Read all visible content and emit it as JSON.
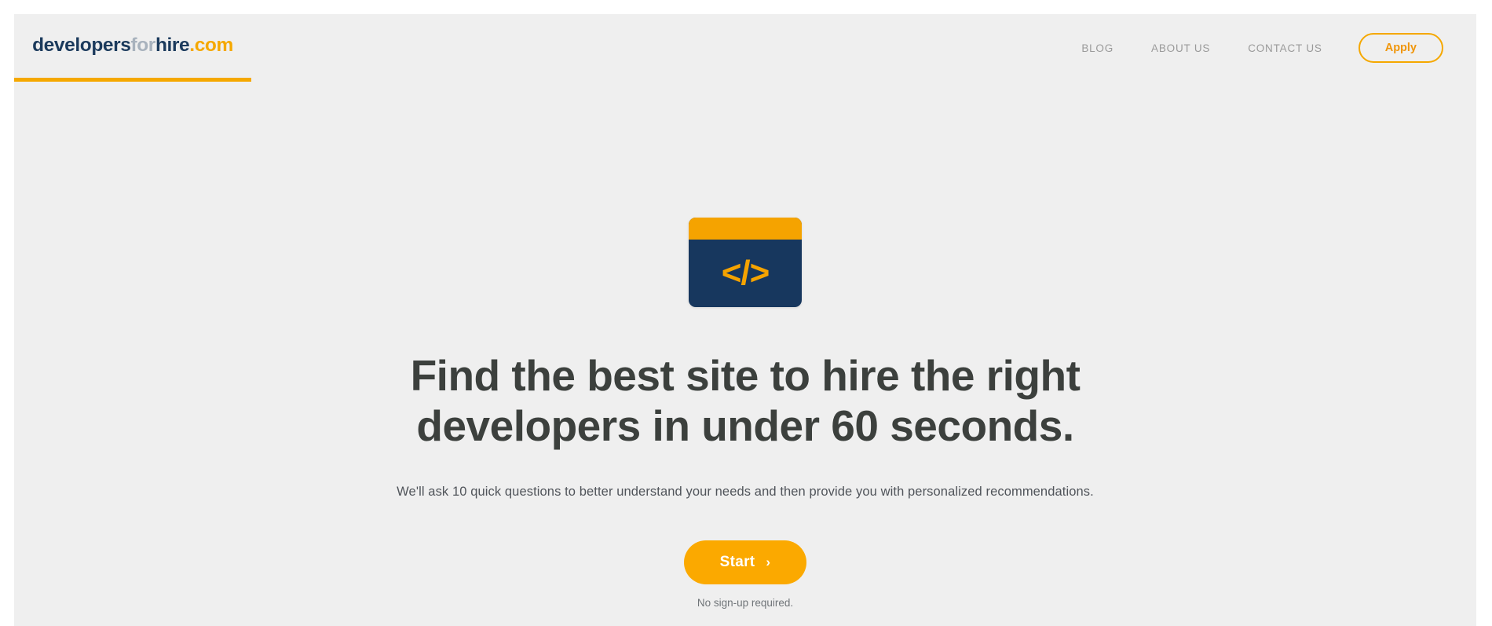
{
  "header": {
    "logo": {
      "part1": "developers",
      "part2": "for",
      "part3": "hire",
      "part4": ".com",
      "full_text": "developersforhire.com",
      "color_part1": "#1b3a5c",
      "color_part2": "#a8b2bd",
      "color_part3": "#1b3a5c",
      "color_part4": "#f5a800",
      "underline_color": "#f5a800"
    },
    "nav": [
      {
        "label": "BLOG"
      },
      {
        "label": "ABOUT US"
      },
      {
        "label": "CONTACT US"
      }
    ],
    "apply_label": "Apply"
  },
  "hero": {
    "icon": {
      "name": "code-brackets-icon",
      "glyph": "</>",
      "topbar_color": "#f5a300",
      "body_color": "#17375e",
      "glyph_color": "#f5a300"
    },
    "headline_line1": "Find the best site to hire the right",
    "headline_line2": "developers in under 60 seconds.",
    "headline_color": "#3c403d",
    "subtitle": "We'll ask 10 quick questions to better understand your needs and then provide you with personalized recommendations.",
    "start_label": "Start",
    "start_chevron": "›",
    "start_color": "#fba900",
    "no_signup_note": "No sign-up required."
  },
  "background": {
    "pattern_glyph": "</>",
    "page_color": "#efefef",
    "pattern_color": "#fbfbfb"
  }
}
